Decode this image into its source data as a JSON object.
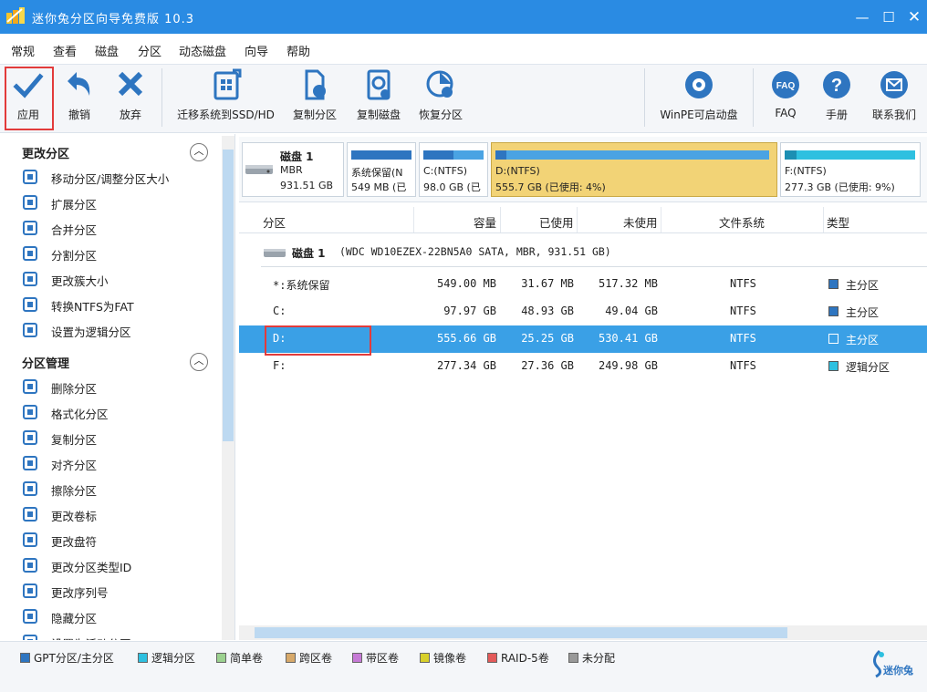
{
  "window": {
    "title": "迷你兔分区向导免费版 10.3"
  },
  "menu": [
    "常规",
    "查看",
    "磁盘",
    "分区",
    "动态磁盘",
    "向导",
    "帮助"
  ],
  "toolbar": {
    "apply": "应用",
    "undo": "撤销",
    "discard": "放弃",
    "migrate": "迁移系统到SSD/HD",
    "copy_partition": "复制分区",
    "copy_disk": "复制磁盘",
    "recover": "恢复分区",
    "winpe": "WinPE可启动盘",
    "faq": "FAQ",
    "manual": "手册",
    "contact": "联系我们"
  },
  "sidebar": {
    "sections": [
      {
        "title": "更改分区",
        "items": [
          {
            "label": "移动分区/调整分区大小",
            "icon": "sliders-icon"
          },
          {
            "label": "扩展分区",
            "icon": "extend-icon"
          },
          {
            "label": "合并分区",
            "icon": "merge-icon"
          },
          {
            "label": "分割分区",
            "icon": "split-icon"
          },
          {
            "label": "更改簇大小",
            "icon": "cluster-icon"
          },
          {
            "label": "转换NTFS为FAT",
            "icon": "convert-icon"
          },
          {
            "label": "设置为逻辑分区",
            "icon": "set-logical-icon"
          }
        ]
      },
      {
        "title": "分区管理",
        "items": [
          {
            "label": "删除分区",
            "icon": "trash-icon"
          },
          {
            "label": "格式化分区",
            "icon": "pencil-icon"
          },
          {
            "label": "复制分区",
            "icon": "copy-icon"
          },
          {
            "label": "对齐分区",
            "icon": "align-icon"
          },
          {
            "label": "擦除分区",
            "icon": "wipe-icon"
          },
          {
            "label": "更改卷标",
            "icon": "tag-icon"
          },
          {
            "label": "更改盘符",
            "icon": "drive-letter-icon"
          },
          {
            "label": "更改分区类型ID",
            "icon": "type-id-icon"
          },
          {
            "label": "更改序列号",
            "icon": "serial-icon"
          },
          {
            "label": "隐藏分区",
            "icon": "hide-icon"
          },
          {
            "label": "设置为活动分区",
            "icon": "active-icon"
          }
        ]
      }
    ]
  },
  "diskmap": {
    "disk": {
      "name": "磁盘 1",
      "type": "MBR",
      "size": "931.51 GB"
    },
    "parts": [
      {
        "l1": "系统保留(N",
        "l2": "549 MB (已",
        "used": 0.06
      },
      {
        "l1": "C:(NTFS)",
        "l2": "98.0 GB (已",
        "used": 0.5
      },
      {
        "l1": "D:(NTFS)",
        "l2": "555.7 GB (已使用: 4%)",
        "used": 0.04
      },
      {
        "l1": "F:(NTFS)",
        "l2": "277.3 GB (已使用: 9%)",
        "used": 0.09
      }
    ]
  },
  "table": {
    "headers": [
      "分区",
      "容量",
      "已使用",
      "未使用",
      "文件系统",
      "类型"
    ],
    "disk_row": {
      "name": "磁盘 1",
      "desc": "(WDC WD10EZEX-22BN5A0 SATA, MBR, 931.51 GB)"
    },
    "rows": [
      {
        "name": "*:系统保留",
        "cap": "549.00 MB",
        "used": "31.67 MB",
        "free": "517.32 MB",
        "fs": "NTFS",
        "type": "主分区",
        "color": "#2e75c0"
      },
      {
        "name": "C:",
        "cap": "97.97 GB",
        "used": "48.93 GB",
        "free": "49.04 GB",
        "fs": "NTFS",
        "type": "主分区",
        "color": "#2e75c0"
      },
      {
        "name": "D:",
        "cap": "555.66 GB",
        "used": "25.25 GB",
        "free": "530.41 GB",
        "fs": "NTFS",
        "type": "主分区",
        "color": "#2e75c0"
      },
      {
        "name": "F:",
        "cap": "277.34 GB",
        "used": "27.36 GB",
        "free": "249.98 GB",
        "fs": "NTFS",
        "type": "逻辑分区",
        "color": "#2ec0e0"
      }
    ]
  },
  "legend": [
    {
      "label": "GPT分区/主分区",
      "color": "#2e75c0"
    },
    {
      "label": "逻辑分区",
      "color": "#2ec0e0"
    },
    {
      "label": "简单卷",
      "color": "#9bd18f"
    },
    {
      "label": "跨区卷",
      "color": "#d7a96a"
    },
    {
      "label": "带区卷",
      "color": "#c67ad6"
    },
    {
      "label": "镜像卷",
      "color": "#d8d02a"
    },
    {
      "label": "RAID-5卷",
      "color": "#e45a5a"
    },
    {
      "label": "未分配",
      "color": "#999999"
    }
  ],
  "brand": "迷你兔",
  "colors": {
    "accent": "#2a8be3",
    "selected_row": "#3aa0e6",
    "highlight": "#e23b3b"
  }
}
